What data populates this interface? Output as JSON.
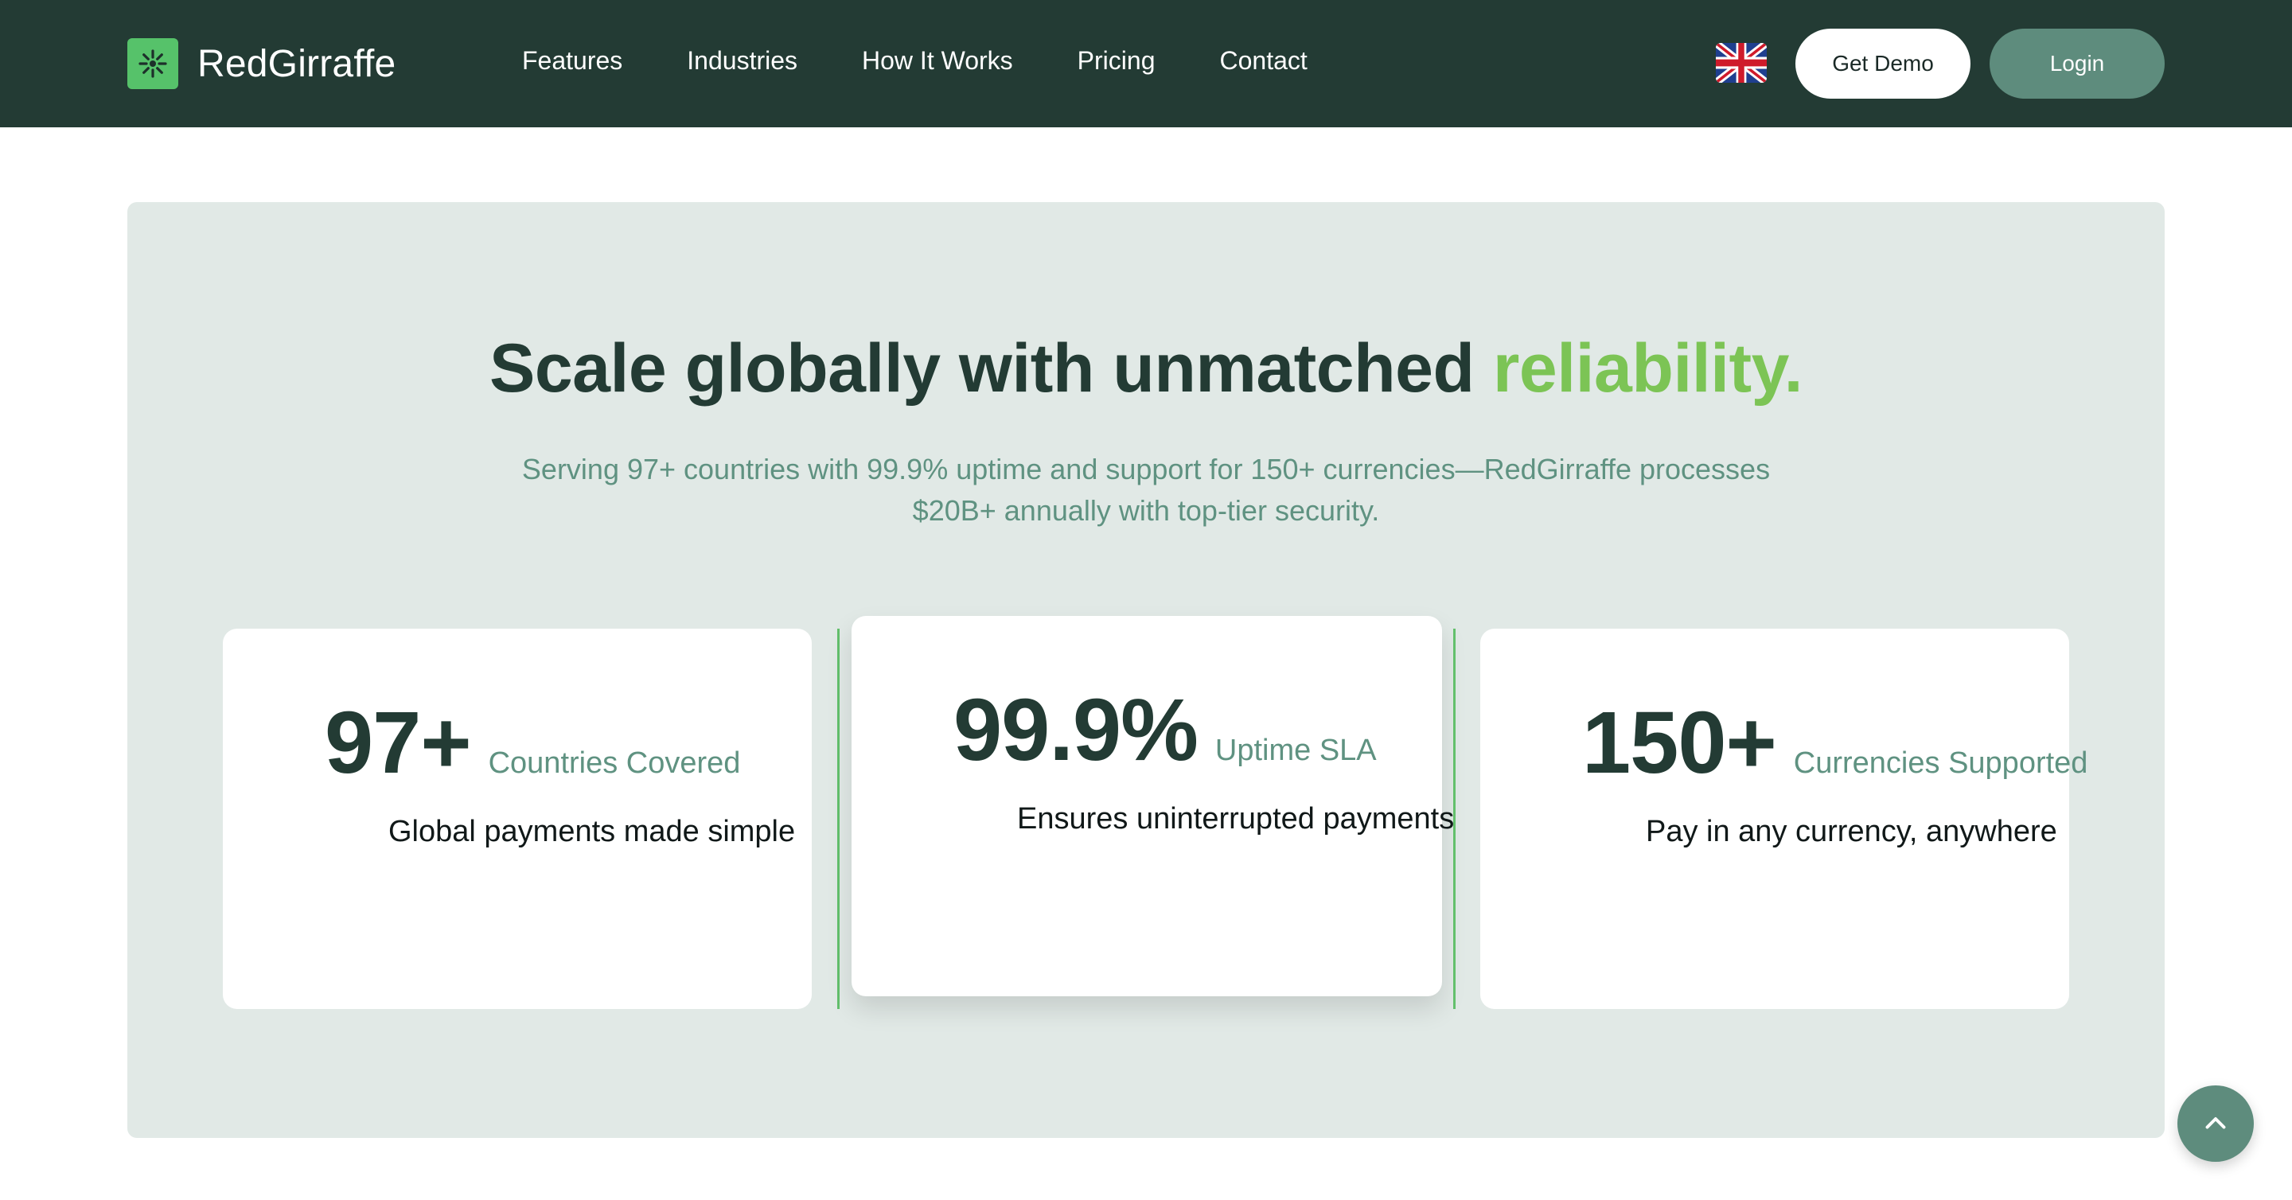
{
  "header": {
    "brand": "RedGirraffe",
    "nav": [
      "Features",
      "Industries",
      "How It Works",
      "Pricing",
      "Contact"
    ],
    "language_icon": "uk-flag-icon",
    "get_demo_label": "Get Demo",
    "login_label": "Login"
  },
  "hero": {
    "title_main": "Scale globally with unmatched ",
    "title_accent": "reliability.",
    "subtitle": "Serving 97+ countries with 99.9% uptime and support for 150+ currencies—RedGirraffe processes $20B+ annually with top-tier security."
  },
  "stats": [
    {
      "value": "97+",
      "label": "Countries Covered",
      "description": "Global payments made simple"
    },
    {
      "value": "99.9%",
      "label": "Uptime SLA",
      "description": "Ensures uninterrupted payments"
    },
    {
      "value": "150+",
      "label": "Currencies Supported",
      "description": "Pay in any currency, anywhere"
    }
  ],
  "colors": {
    "header_bg": "#233b34",
    "accent_green": "#7cc455",
    "brand_green": "#56c26a",
    "panel_bg": "#e1e9e6",
    "muted_teal": "#5f9281",
    "login_bg": "#5e8c7d"
  },
  "scroll_top_icon": "chevron-up-icon"
}
